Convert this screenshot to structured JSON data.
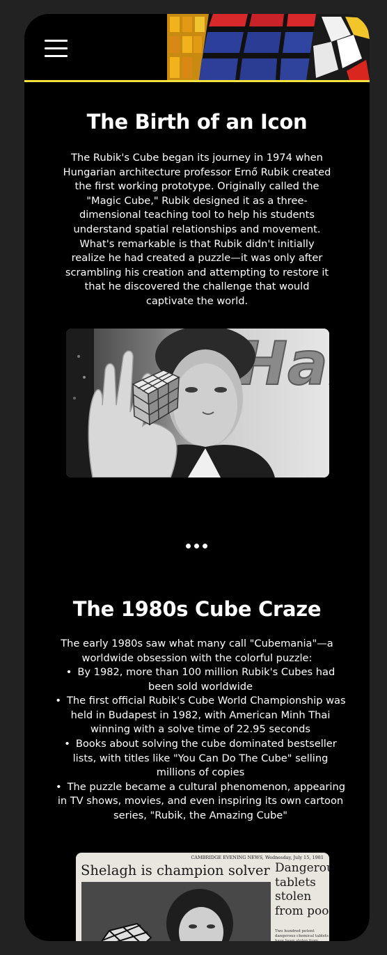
{
  "header": {
    "menu_icon": "hamburger-menu-icon",
    "accent_color": "#f5e33d"
  },
  "section1": {
    "title": "The Birth of an Icon",
    "body": "The Rubik's Cube began its journey in 1974 when Hungarian architecture professor Ernő Rubik created the first working prototype. Originally called the \"Magic Cube,\" Rubik designed it as a three-dimensional teaching tool to help his students understand spatial relationships and movement. What's remarkable is that Rubik didn't initially realize he had created a puzzle—it was only after scrambling his creation and attempting to restore it that he discovered the challenge that would captivate the world.",
    "photo_sign_text": "Har"
  },
  "section2": {
    "title": "The 1980s Cube Craze",
    "intro": "The early 1980s saw what many call \"Cubemania\"—a worldwide obsession with the colorful puzzle:",
    "items": [
      "By 1982, more than 100 million Rubik's Cubes had been sold worldwide",
      "The first official Rubik's Cube World Championship was held in Budapest in 1982, with American Minh Thai winning with a solve time of 22.95 seconds",
      "Books about solving the cube dominated bestseller lists, with titles like \"You Can Do The Cube\" selling millions of copies",
      "The puzzle became a cultural phenomenon, appearing in TV shows, movies, and even inspiring its own cartoon series, \"Rubik, the Amazing Cube\""
    ],
    "newspaper": {
      "masthead": "CAMBRIDGE EVENING NEWS, Wednesday, July 15, 1981",
      "headline": "Shelagh is champion solver",
      "side_headline": "Dangerous tablets stolen from poo",
      "side_small": "Two hundred potent dangerous chemical tablets have been stolen from Abbey Pool on Coldham"
    }
  }
}
